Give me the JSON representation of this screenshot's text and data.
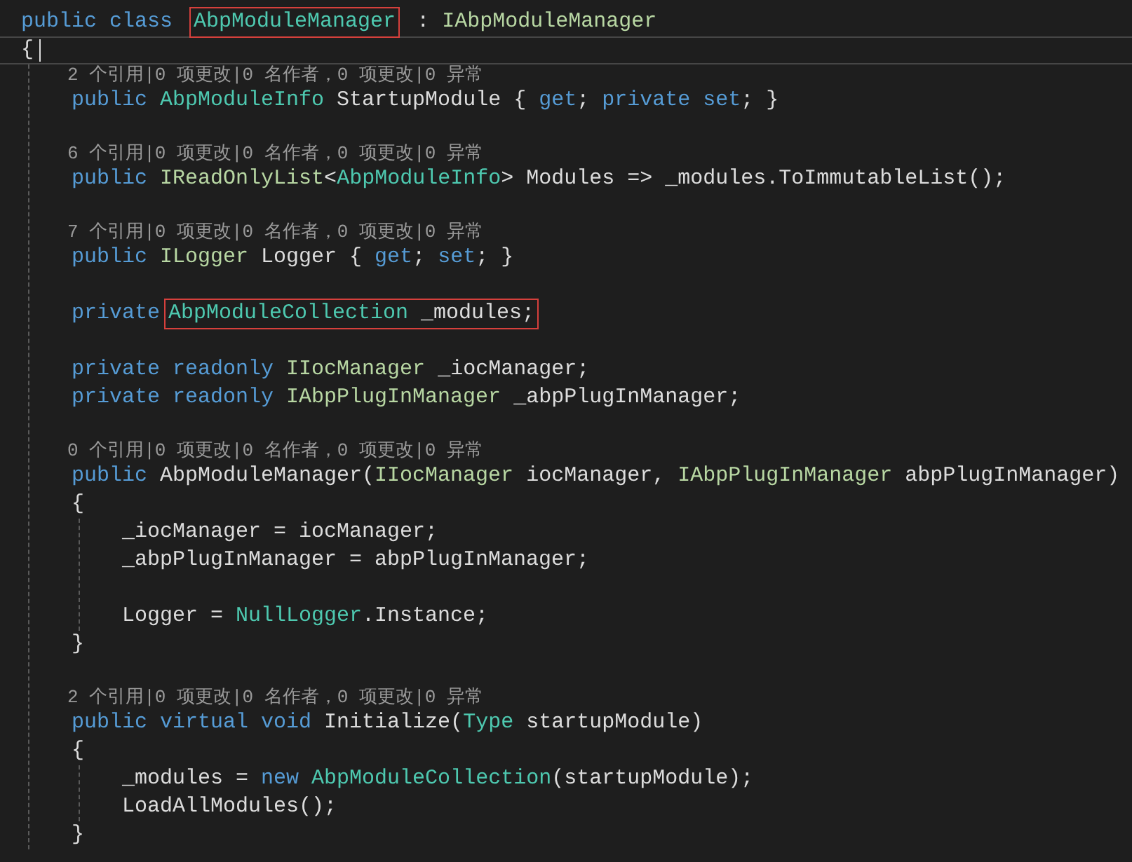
{
  "lines": [
    {
      "current": false,
      "segments": [
        {
          "boxed": false,
          "tokens": [
            {
              "kind": "keyword",
              "text": "public class "
            }
          ]
        },
        {
          "boxed": true,
          "tokens": [
            {
              "kind": "class",
              "text": "AbpModuleManager"
            }
          ]
        },
        {
          "boxed": false,
          "tokens": [
            {
              "kind": "plain",
              "text": " : "
            },
            {
              "kind": "interface",
              "text": "IAbpModuleManager"
            }
          ]
        }
      ]
    },
    {
      "current": true,
      "segments": [
        {
          "boxed": false,
          "tokens": [
            {
              "kind": "plain",
              "text": "{"
            }
          ]
        }
      ],
      "children": [
        {
          "current": false,
          "codelens": "2 个引用|0 项更改|0 名作者，0 项更改|0 异常",
          "segments": [
            {
              "boxed": false,
              "tokens": [
                {
                  "kind": "keyword",
                  "text": "public "
                },
                {
                  "kind": "class",
                  "text": "AbpModuleInfo"
                },
                {
                  "kind": "plain",
                  "text": " StartupModule { "
                },
                {
                  "kind": "keyword",
                  "text": "get"
                },
                {
                  "kind": "plain",
                  "text": "; "
                },
                {
                  "kind": "keyword",
                  "text": "private set"
                },
                {
                  "kind": "plain",
                  "text": "; }"
                }
              ]
            }
          ]
        },
        {
          "current": false
        },
        {
          "current": false,
          "codelens": "6 个引用|0 项更改|0 名作者，0 项更改|0 异常",
          "segments": [
            {
              "boxed": false,
              "tokens": [
                {
                  "kind": "keyword",
                  "text": "public "
                },
                {
                  "kind": "interface",
                  "text": "IReadOnlyList"
                },
                {
                  "kind": "plain",
                  "text": "<"
                },
                {
                  "kind": "class",
                  "text": "AbpModuleInfo"
                },
                {
                  "kind": "plain",
                  "text": "> Modules => _modules.ToImmutableList();"
                }
              ]
            }
          ]
        },
        {
          "current": false
        },
        {
          "current": false,
          "codelens": "7 个引用|0 项更改|0 名作者，0 项更改|0 异常",
          "segments": [
            {
              "boxed": false,
              "tokens": [
                {
                  "kind": "keyword",
                  "text": "public "
                },
                {
                  "kind": "interface",
                  "text": "ILogger"
                },
                {
                  "kind": "plain",
                  "text": " Logger { "
                },
                {
                  "kind": "keyword",
                  "text": "get"
                },
                {
                  "kind": "plain",
                  "text": "; "
                },
                {
                  "kind": "keyword",
                  "text": "set"
                },
                {
                  "kind": "plain",
                  "text": "; }"
                }
              ]
            }
          ]
        },
        {
          "current": false
        },
        {
          "current": false,
          "segments": [
            {
              "boxed": false,
              "tokens": [
                {
                  "kind": "keyword",
                  "text": "private"
                }
              ]
            },
            {
              "boxed": true,
              "tokens": [
                {
                  "kind": "class",
                  "text": "AbpModuleCollection"
                },
                {
                  "kind": "plain",
                  "text": " _modules;"
                }
              ]
            }
          ]
        },
        {
          "current": false
        },
        {
          "current": false,
          "segments": [
            {
              "boxed": false,
              "tokens": [
                {
                  "kind": "keyword",
                  "text": "private readonly "
                },
                {
                  "kind": "interface",
                  "text": "IIocManager"
                },
                {
                  "kind": "plain",
                  "text": " _iocManager;"
                }
              ]
            }
          ]
        },
        {
          "current": false,
          "segments": [
            {
              "boxed": false,
              "tokens": [
                {
                  "kind": "keyword",
                  "text": "private readonly "
                },
                {
                  "kind": "interface",
                  "text": "IAbpPlugInManager"
                },
                {
                  "kind": "plain",
                  "text": " _abpPlugInManager;"
                }
              ]
            }
          ]
        },
        {
          "current": false
        },
        {
          "current": false,
          "codelens": "0 个引用|0 项更改|0 名作者，0 项更改|0 异常",
          "segments": [
            {
              "boxed": false,
              "tokens": [
                {
                  "kind": "keyword",
                  "text": "public "
                },
                {
                  "kind": "plain",
                  "text": "AbpModuleManager("
                },
                {
                  "kind": "interface",
                  "text": "IIocManager"
                },
                {
                  "kind": "plain",
                  "text": " iocManager, "
                },
                {
                  "kind": "interface",
                  "text": "IAbpPlugInManager"
                },
                {
                  "kind": "plain",
                  "text": " abpPlugInManager)"
                }
              ]
            }
          ]
        },
        {
          "current": false,
          "segments": [
            {
              "boxed": false,
              "tokens": [
                {
                  "kind": "plain",
                  "text": "{"
                }
              ]
            }
          ],
          "children": [
            {
              "current": false,
              "segments": [
                {
                  "boxed": false,
                  "tokens": [
                    {
                      "kind": "plain",
                      "text": "_iocManager = iocManager;"
                    }
                  ]
                }
              ]
            },
            {
              "current": false,
              "segments": [
                {
                  "boxed": false,
                  "tokens": [
                    {
                      "kind": "plain",
                      "text": "_abpPlugInManager = abpPlugInManager;"
                    }
                  ]
                }
              ]
            },
            {
              "current": false
            },
            {
              "current": false,
              "segments": [
                {
                  "boxed": false,
                  "tokens": [
                    {
                      "kind": "plain",
                      "text": "Logger = "
                    },
                    {
                      "kind": "class",
                      "text": "NullLogger"
                    },
                    {
                      "kind": "plain",
                      "text": ".Instance;"
                    }
                  ]
                }
              ]
            }
          ]
        },
        {
          "current": false,
          "segments": [
            {
              "boxed": false,
              "tokens": [
                {
                  "kind": "plain",
                  "text": "}"
                }
              ]
            }
          ]
        },
        {
          "current": false
        },
        {
          "current": false,
          "codelens": "2 个引用|0 项更改|0 名作者，0 项更改|0 异常",
          "segments": [
            {
              "boxed": false,
              "tokens": [
                {
                  "kind": "keyword",
                  "text": "public virtual void "
                },
                {
                  "kind": "plain",
                  "text": "Initialize("
                },
                {
                  "kind": "class",
                  "text": "Type"
                },
                {
                  "kind": "plain",
                  "text": " startupModule)"
                }
              ]
            }
          ]
        },
        {
          "current": false,
          "segments": [
            {
              "boxed": false,
              "tokens": [
                {
                  "kind": "plain",
                  "text": "{"
                }
              ]
            }
          ],
          "children": [
            {
              "current": false,
              "segments": [
                {
                  "boxed": false,
                  "tokens": [
                    {
                      "kind": "plain",
                      "text": "_modules = "
                    },
                    {
                      "kind": "keyword",
                      "text": "new "
                    },
                    {
                      "kind": "class",
                      "text": "AbpModuleCollection"
                    },
                    {
                      "kind": "plain",
                      "text": "(startupModule);"
                    }
                  ]
                }
              ]
            },
            {
              "current": false,
              "segments": [
                {
                  "boxed": false,
                  "tokens": [
                    {
                      "kind": "plain",
                      "text": "LoadAllModules();"
                    }
                  ]
                }
              ]
            }
          ]
        },
        {
          "current": false,
          "segments": [
            {
              "boxed": false,
              "tokens": [
                {
                  "kind": "plain",
                  "text": "}"
                }
              ]
            }
          ]
        }
      ]
    }
  ]
}
